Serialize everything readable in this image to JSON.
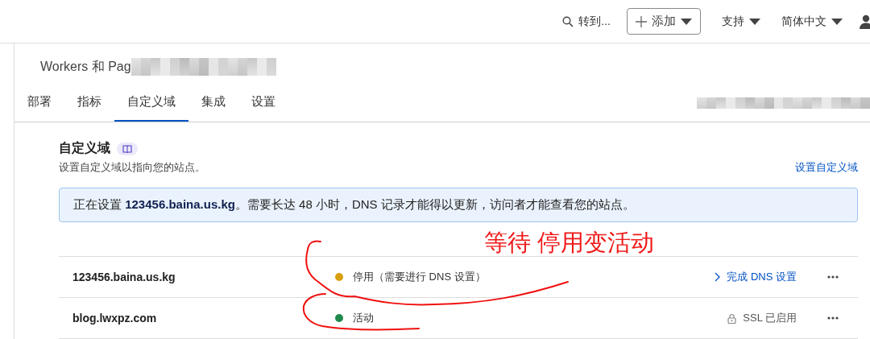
{
  "header": {
    "search": {
      "label": "转到..."
    },
    "add_button": {
      "label": "添加"
    },
    "menus": [
      {
        "label": "支持"
      },
      {
        "label": "简体中文"
      }
    ]
  },
  "page": {
    "title": "Workers 和 Pag",
    "tabs": [
      {
        "label": "部署",
        "selected": false
      },
      {
        "label": "指标",
        "selected": false
      },
      {
        "label": "自定义域",
        "selected": true
      },
      {
        "label": "集成",
        "selected": false
      },
      {
        "label": "设置",
        "selected": false
      }
    ]
  },
  "section": {
    "title": "自定义域",
    "description": "设置自定义域以指向您的站点。",
    "link": "设置自定义域"
  },
  "notice": "正在设置 **123456.baina.us.kg**。需要长达 48 小时，DNS 记录才能得以更新，访问者才能查看您的站点。",
  "domains": [
    {
      "name": "123456.baina.us.kg",
      "status": "停用（需要进行 DNS 设置）",
      "color": "#d99e0b",
      "action": {
        "kind": "link",
        "label": "完成 DNS 设置"
      }
    },
    {
      "name": "blog.lwxpz.com",
      "status": "活动",
      "color": "#1e8a4c",
      "action": {
        "kind": "ssl",
        "label": "SSL 已启用"
      }
    }
  ],
  "annotation": {
    "text": "等待 停用变活动"
  }
}
